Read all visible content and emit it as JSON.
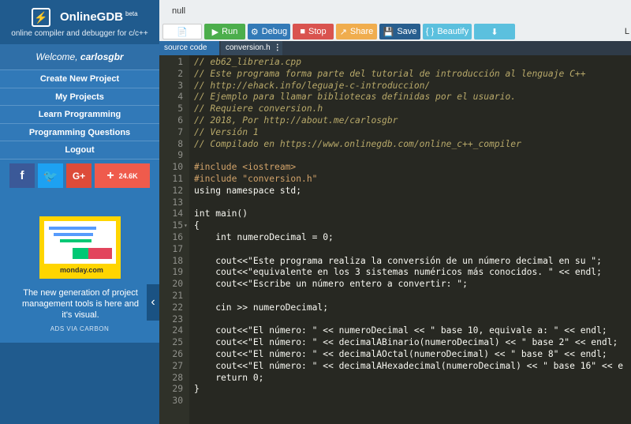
{
  "brand": {
    "logo_glyph": "⚡",
    "title": "OnlineGDB",
    "beta": "beta",
    "tagline": "online compiler and debugger for c/c++"
  },
  "welcome": {
    "prefix": "Welcome, ",
    "user": "carlosgbr"
  },
  "nav": [
    {
      "label": "Create New Project"
    },
    {
      "label": "My Projects"
    },
    {
      "label": "Learn Programming"
    },
    {
      "label": "Programming Questions"
    },
    {
      "label": "Logout"
    }
  ],
  "social": {
    "facebook": "f",
    "twitter": "🐦",
    "google": "G+",
    "share_plus": "+",
    "share_count": "24.6K"
  },
  "ad": {
    "brand": "monday.com",
    "text": "The new generation of project management tools is here and it's visual.",
    "via": "ADS VIA CARBON"
  },
  "topbar": {
    "null_text": "null"
  },
  "toolbar": {
    "file_icon": "📄",
    "run_icon": "▶",
    "run": "Run",
    "debug_icon": "⚙",
    "debug": "Debug",
    "stop_icon": "■",
    "stop": "Stop",
    "share_icon": "↗",
    "share": "Share",
    "save_icon": "💾",
    "save": "Save",
    "beautify_icon": "{ }",
    "beautify": "Beautify",
    "download_icon": "⬇",
    "language": "L"
  },
  "tabs": [
    {
      "label": "source code"
    },
    {
      "label": "conversion.h",
      "menu": "⋮"
    }
  ],
  "code": [
    {
      "n": "1",
      "text": "// eb62_libreria.cpp",
      "type": "comment"
    },
    {
      "n": "2",
      "text": "// Este programa forma parte del tutorial de introducción al lenguaje C++",
      "type": "comment"
    },
    {
      "n": "3",
      "text": "// http://ehack.info/leguaje-c-introduccion/",
      "type": "comment"
    },
    {
      "n": "4",
      "text": "// Ejemplo para llamar bibliotecas definidas por el usuario.",
      "type": "comment"
    },
    {
      "n": "5",
      "text": "// Requiere conversion.h",
      "type": "comment"
    },
    {
      "n": "6",
      "text": "// 2018, Por http://about.me/carlosgbr",
      "type": "comment"
    },
    {
      "n": "7",
      "text": "// Versión 1",
      "type": "comment"
    },
    {
      "n": "8",
      "text": "// Compilado en https://www.onlinegdb.com/online_c++_compiler",
      "type": "comment"
    },
    {
      "n": "9",
      "text": "",
      "type": "plain"
    },
    {
      "n": "10",
      "text": "#include <iostream>",
      "type": "pre"
    },
    {
      "n": "11",
      "text": "#include \"conversion.h\"",
      "type": "pre"
    },
    {
      "n": "12",
      "text": "using namespace std;",
      "type": "plain"
    },
    {
      "n": "13",
      "text": "",
      "type": "plain"
    },
    {
      "n": "14",
      "text": "int main()",
      "type": "plain"
    },
    {
      "n": "15",
      "text": "{",
      "type": "plain",
      "fold": "▾"
    },
    {
      "n": "16",
      "text": "    int numeroDecimal = 0;",
      "type": "plain"
    },
    {
      "n": "17",
      "text": "",
      "type": "plain"
    },
    {
      "n": "18",
      "text": "    cout<<\"Este programa realiza la conversión de un número decimal en su \";",
      "type": "plain"
    },
    {
      "n": "19",
      "text": "    cout<<\"equivalente en los 3 sistemas numéricos más conocidos. \" << endl;",
      "type": "plain"
    },
    {
      "n": "20",
      "text": "    cout<<\"Escribe un número entero a convertir: \";",
      "type": "plain"
    },
    {
      "n": "21",
      "text": "",
      "type": "plain"
    },
    {
      "n": "22",
      "text": "    cin >> numeroDecimal;",
      "type": "plain"
    },
    {
      "n": "23",
      "text": "",
      "type": "plain"
    },
    {
      "n": "24",
      "text": "    cout<<\"El número: \" << numeroDecimal << \" base 10, equivale a: \" << endl;",
      "type": "plain"
    },
    {
      "n": "25",
      "text": "    cout<<\"El número: \" << decimalABinario(numeroDecimal) << \" base 2\" << endl;",
      "type": "plain"
    },
    {
      "n": "26",
      "text": "    cout<<\"El número: \" << decimalAOctal(numeroDecimal) << \" base 8\" << endl;",
      "type": "plain"
    },
    {
      "n": "27",
      "text": "    cout<<\"El número: \" << decimalAHexadecimal(numeroDecimal) << \" base 16\" << e",
      "type": "plain"
    },
    {
      "n": "28",
      "text": "    return 0;",
      "type": "plain"
    },
    {
      "n": "29",
      "text": "}",
      "type": "plain"
    },
    {
      "n": "30",
      "text": "",
      "type": "plain"
    }
  ]
}
